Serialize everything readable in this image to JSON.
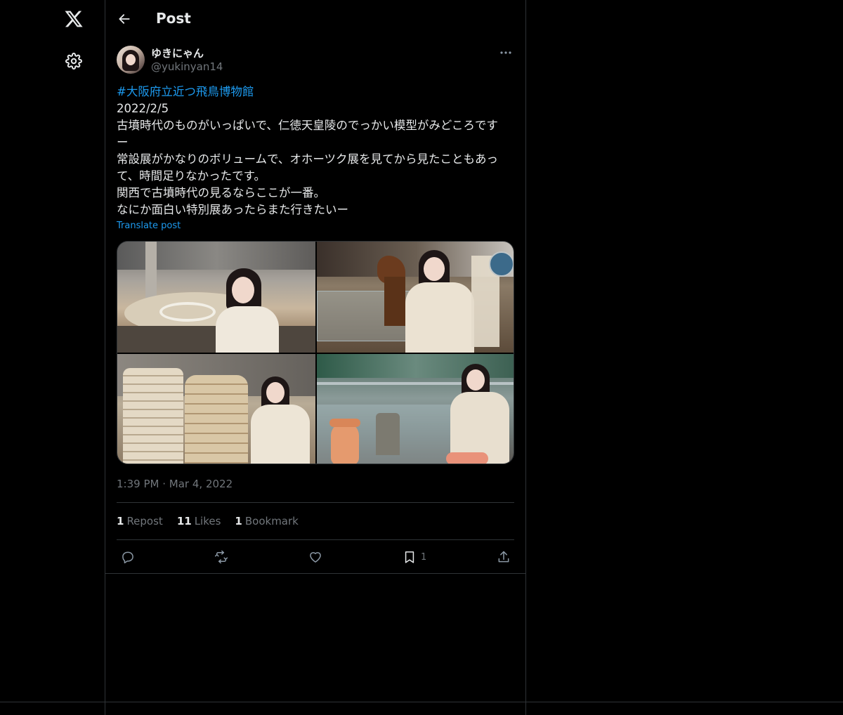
{
  "nav": {
    "logo_icon": "x-logo-icon",
    "settings_icon": "gear-icon"
  },
  "header": {
    "title": "Post",
    "back_icon": "arrow-left-icon"
  },
  "post": {
    "author": {
      "display_name": "ゆきにゃん",
      "handle": "@yukinyan14"
    },
    "text": {
      "hashtag": "#大阪府立近つ飛鳥博物館",
      "lines": [
        "2022/2/5",
        "古墳時代のものがいっぱいで、仁徳天皇陵のでっかい模型がみどころです",
        "ー",
        "常設展がかなりのボリュームで、オホーツク展を見てから見たこともあっ",
        "て、時間足りなかったです。",
        "関西で古墳時代の見るならここが一番。",
        "なにか面白い特別展あったらまた行きたいー"
      ]
    },
    "translate_label": "Translate post",
    "timestamp": {
      "time": "1:39 PM",
      "separator": "·",
      "date": "Mar 4, 2022"
    },
    "stats": {
      "reposts": {
        "count": "1",
        "label": "Repost"
      },
      "likes": {
        "count": "11",
        "label": "Likes"
      },
      "bookmarks": {
        "count": "1",
        "label": "Bookmark"
      }
    },
    "actions": {
      "reply_icon": "reply-icon",
      "repost_icon": "repost-icon",
      "like_icon": "heart-icon",
      "bookmark_icon": "bookmark-icon",
      "bookmark_count": "1",
      "share_icon": "share-icon"
    }
  },
  "colors": {
    "background": "#000000",
    "text_primary": "#e7e9ea",
    "text_secondary": "#71767b",
    "accent": "#1d9bf0",
    "border": "#2f3336"
  }
}
